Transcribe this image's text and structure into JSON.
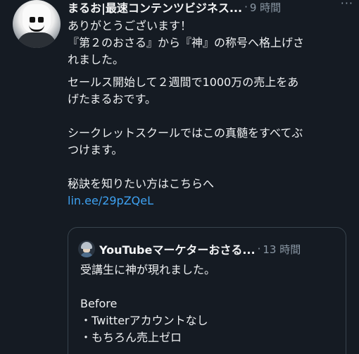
{
  "tweet": {
    "author_name": "まるお|最速コンテンツビジネス...",
    "separator": "·",
    "time": "9 時間",
    "more": "···",
    "lines": {
      "l1": "ありがとうございます！",
      "l2": "『第２のおさる』から『神』の称号へ格上げさ",
      "l3": "れました。",
      "l4": "セールス開始して２週間で1000万の売上をあ",
      "l5": "げたまるおです。",
      "l6": "シークレットスクールではこの真髄をすべてぶ",
      "l7": "つけます。",
      "l8": "秘訣を知りたい方はこちらへ"
    },
    "link_text": "lin.ee/29pZQeL"
  },
  "quote": {
    "author_name": "YouTubeマーケターおさる...",
    "separator": "·",
    "time": "13 時間",
    "lines": {
      "l1": "受講生に神が現れました。",
      "l2": "Before",
      "l3": "・Twitterアカウントなし",
      "l4": "・もちろん売上ゼロ"
    }
  },
  "colors": {
    "background": "#151b23",
    "link": "#3ea2f2",
    "muted": "#8b98a5",
    "border": "#38444d"
  }
}
